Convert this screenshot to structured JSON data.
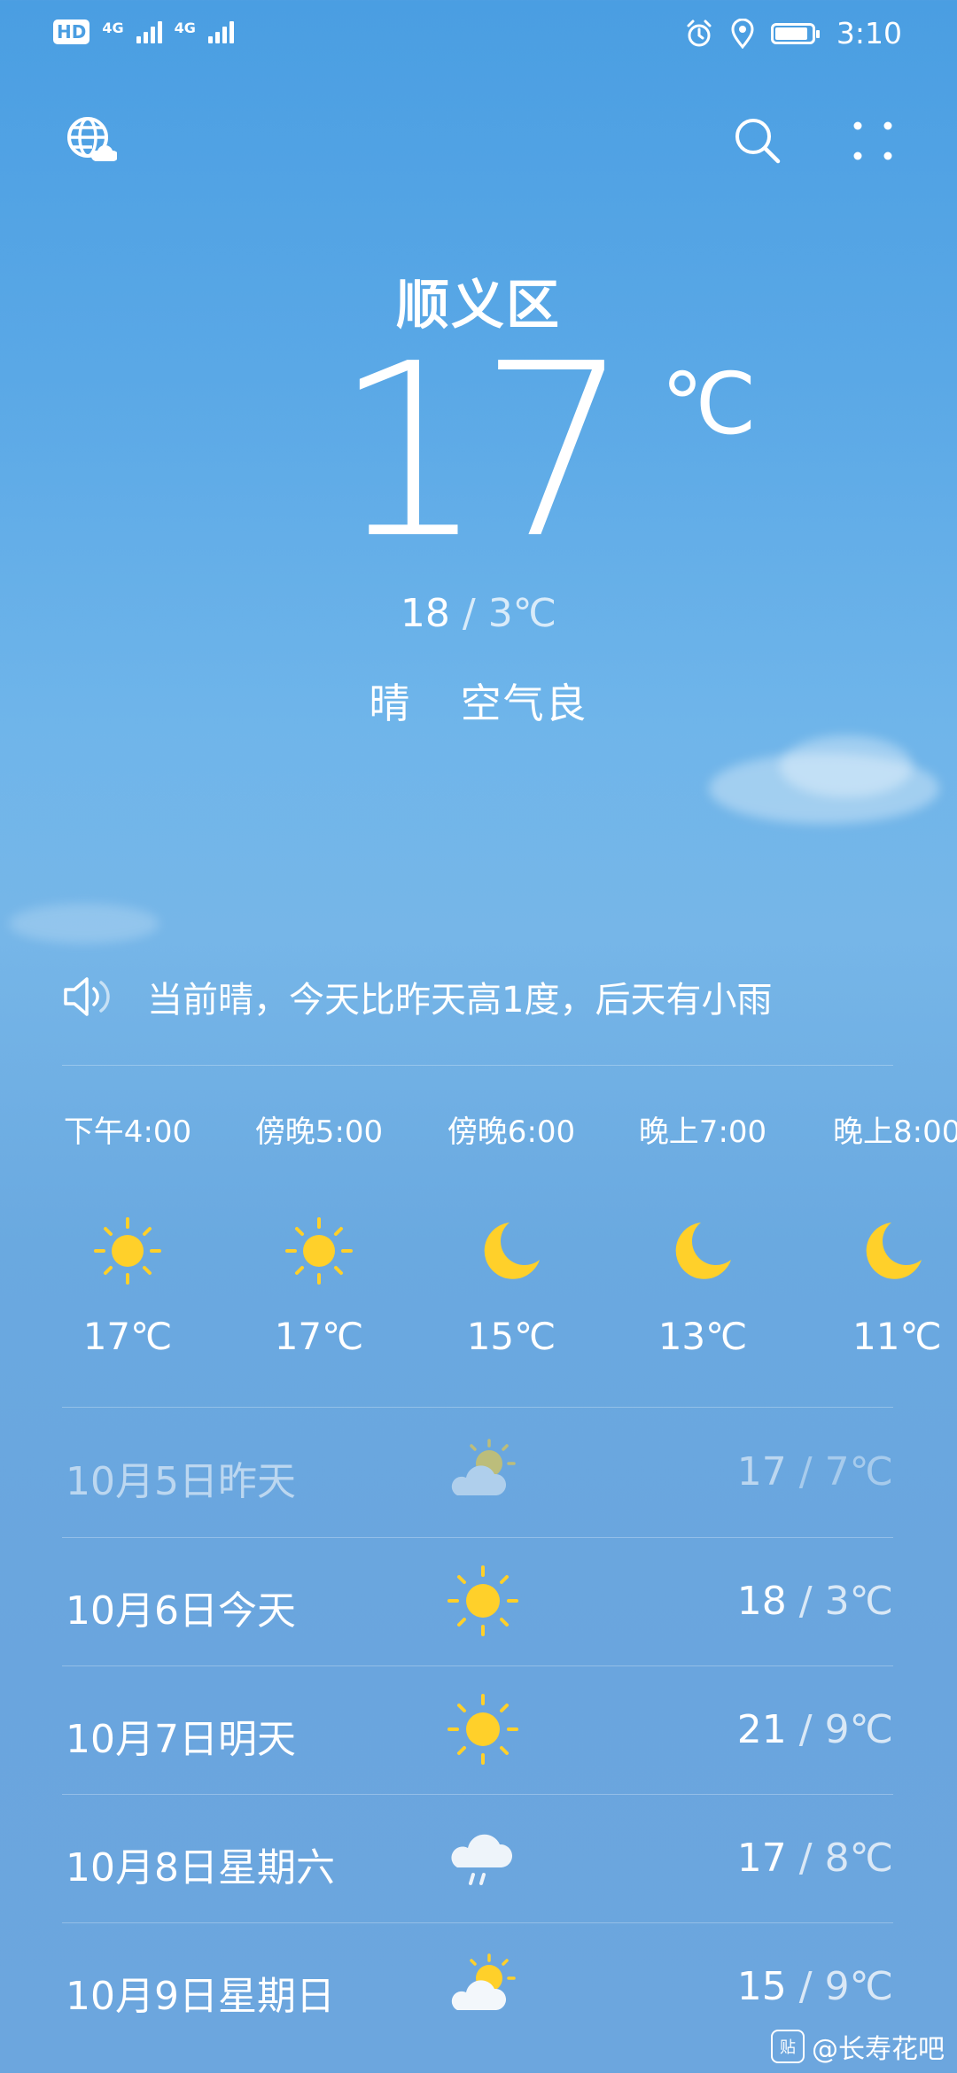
{
  "status_bar": {
    "hd_label": "HD",
    "sim1_net": "4G",
    "sim2_net": "4G",
    "time": "3:10"
  },
  "location": {
    "city": "顺义区",
    "current_temp": "17",
    "temp_unit": "℃",
    "high": "18",
    "low_sep": " / ",
    "low": "3℃",
    "condition": "晴",
    "air_quality": "空气良"
  },
  "brief": {
    "text": "当前晴，今天比昨天高1度，后天有小雨"
  },
  "hourly": [
    {
      "time": "下午4:00",
      "icon": "sun-icon",
      "temp": "17℃"
    },
    {
      "time": "傍晚5:00",
      "icon": "sun-icon",
      "temp": "17℃"
    },
    {
      "time": "傍晚6:00",
      "icon": "moon-icon",
      "temp": "15℃"
    },
    {
      "time": "晚上7:00",
      "icon": "moon-icon",
      "temp": "13℃"
    },
    {
      "time": "晚上8:00",
      "icon": "moon-icon",
      "temp": "11℃"
    }
  ],
  "daily": [
    {
      "date": "10月5日昨天",
      "icon": "partly-cloudy-icon",
      "high": "17",
      "sep": " / ",
      "low": "7℃",
      "past": true
    },
    {
      "date": "10月6日今天",
      "icon": "sun-icon",
      "high": "18",
      "sep": " / ",
      "low": "3℃",
      "past": false
    },
    {
      "date": "10月7日明天",
      "icon": "sun-icon",
      "high": "21",
      "sep": " / ",
      "low": "9℃",
      "past": false
    },
    {
      "date": "10月8日星期六",
      "icon": "light-rain-icon",
      "high": "17",
      "sep": " / ",
      "low": "8℃",
      "past": false
    },
    {
      "date": "10月9日星期日",
      "icon": "partly-cloudy-icon",
      "high": "15",
      "sep": " / ",
      "low": "9℃",
      "past": false
    }
  ],
  "watermark": {
    "badge": "贴",
    "text": "@长寿花吧"
  },
  "colors": {
    "sun": "#FFD02A",
    "moon": "#FFD02A",
    "sky_top": "#4a9ee2",
    "sky_bottom": "#6ca6de"
  }
}
